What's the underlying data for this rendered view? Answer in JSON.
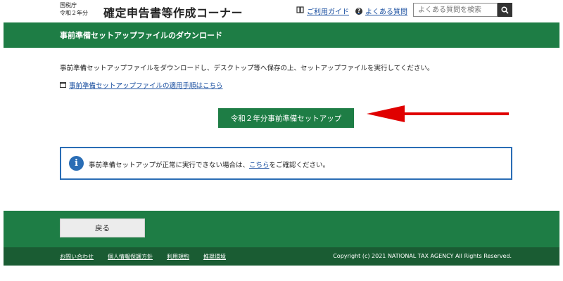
{
  "header": {
    "agency": "国税庁",
    "year": "令和２年分",
    "title": "確定申告書等作成コーナー",
    "guide_link": "ご利用ガイド",
    "faq_link": "よくある質問",
    "search_placeholder": "よくある質問を検索"
  },
  "banner": {
    "title": "事前準備セットアップファイルのダウンロード"
  },
  "main": {
    "description": "事前準備セットアップファイルをダウンロードし、デスクトップ等へ保存の上、セットアップファイルを実行してください。",
    "procedure_link": "事前準備セットアップファイルの適用手順はこちら",
    "setup_button": "令和２年分事前準備セットアップ",
    "info_prefix": "事前準備セットアップが正常に実行できない場合は、",
    "info_link": "こちら",
    "info_suffix": "をご確認ください。"
  },
  "footer": {
    "back_button": "戻る",
    "links": [
      "お問い合わせ",
      "個人情報保護方針",
      "利用規約",
      "推奨環境"
    ],
    "copyright": "Copyright (c) 2021 NATIONAL TAX AGENCY All Rights Reserved."
  },
  "colors": {
    "brand_green": "#1e7d45",
    "footer_dark_green": "#1a5c33",
    "info_blue": "#2a6db5",
    "arrow_red": "#e00000"
  },
  "icons": {
    "guide": "book-icon",
    "faq": "question-circle-icon",
    "search": "search-icon",
    "procedure": "window-icon",
    "info": "info-icon",
    "annotation": "red-arrow-icon"
  }
}
